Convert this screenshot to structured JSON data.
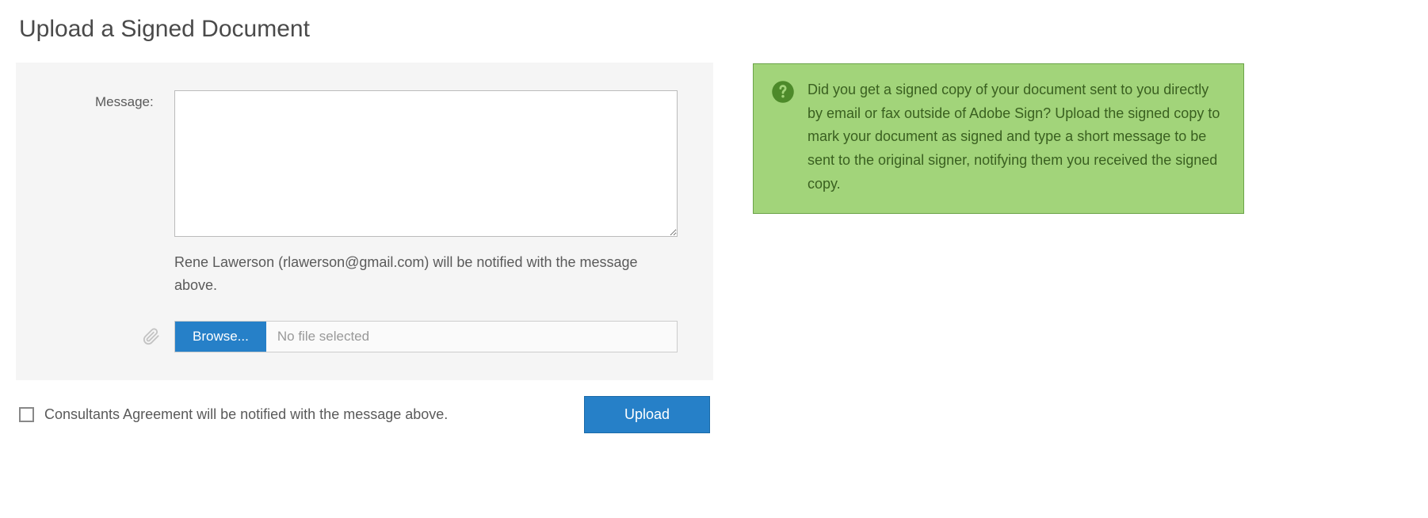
{
  "title": "Upload a Signed Document",
  "form": {
    "message_label": "Message:",
    "message_value": "",
    "notify_text": "Rene Lawerson (rlawerson@gmail.com) will be notified with the message above.",
    "browse_label": "Browse...",
    "file_placeholder": "No file selected",
    "checkbox_label": "Consultants Agreement will be notified with the message above.",
    "upload_label": "Upload"
  },
  "help": {
    "text": "Did you get a signed copy of your document sent to you directly by email or fax outside of Adobe Sign? Upload the signed copy to mark your document as signed and type a short message to be sent to the original signer, notifying them you received the signed copy."
  }
}
